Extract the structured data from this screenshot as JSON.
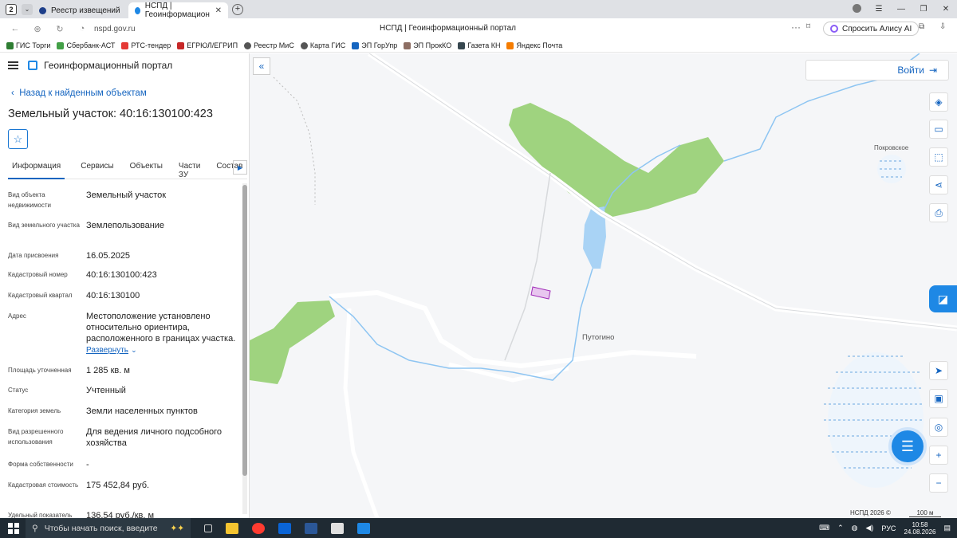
{
  "browser": {
    "tab_count": "2",
    "tabs": [
      {
        "title": "Реестр извещений",
        "active": false
      },
      {
        "title": "НСПД | Геоинформацион",
        "active": true
      }
    ],
    "url": "nspd.gov.ru",
    "page_title": "НСПД | Геоинформационный портал",
    "alice_label": "Спросить Алису AI",
    "bookmarks": [
      "ГИС Торги",
      "Сбербанк-АСТ",
      "РТС-тендер",
      "ЕГРЮЛ/ЕГРИП",
      "Реестр МиС",
      "Карта ГИС",
      "ЭП ГорУпр",
      "ЭП ПрокКО",
      "Газета КН",
      "Яндекс Почта"
    ]
  },
  "panel": {
    "portal_title": "Геоинформационный портал",
    "back_link": "Назад к найденным объектам",
    "object_title": "Земельный участок: 40:16:130100:423",
    "tabs": [
      "Информация",
      "Сервисы",
      "Объекты",
      "Части ЗУ",
      "Состав"
    ],
    "rows": [
      {
        "key": "Вид объекта недвижимости",
        "value": "Земельный участок"
      },
      {
        "key": "Вид земельного участка",
        "value": "Землепользование"
      },
      {
        "key": "Дата присвоения",
        "value": "16.05.2025"
      },
      {
        "key": "Кадастровый номер",
        "value": "40:16:130100:423"
      },
      {
        "key": "Кадастровый квартал",
        "value": "40:16:130100"
      },
      {
        "key": "Адрес",
        "value": "Местоположение установлено относительно ориентира, расположенного в границах участка."
      },
      {
        "key": "Площадь уточненная",
        "value": "1 285 кв. м"
      },
      {
        "key": "Статус",
        "value": "Учтенный"
      },
      {
        "key": "Категория земель",
        "value": "Земли населенных пунктов"
      },
      {
        "key": "Вид разрешенного использования",
        "value": "Для ведения личного подсобного хозяйства"
      },
      {
        "key": "Форма собственности",
        "value": "-"
      },
      {
        "key": "Кадастровая стоимость",
        "value": "175 452,84 руб."
      },
      {
        "key": "Удельный показатель",
        "value": "136,54 руб./кв. м"
      }
    ],
    "expand_link": "Развернуть"
  },
  "map": {
    "login_label": "Войти",
    "place_labels": [
      "Путогино",
      "Покровское"
    ],
    "copyright": "НСПД 2026 ©",
    "scale": "100 м"
  },
  "taskbar": {
    "search_placeholder": "Чтобы начать поиск, введите",
    "lang": "РУС",
    "time": "10:58",
    "date": "24.08.2026"
  },
  "colors": {
    "accent": "#1565c0",
    "forest": "#9fd37f",
    "water": "#a9d3f5",
    "parcel": "#e8c6ef"
  }
}
